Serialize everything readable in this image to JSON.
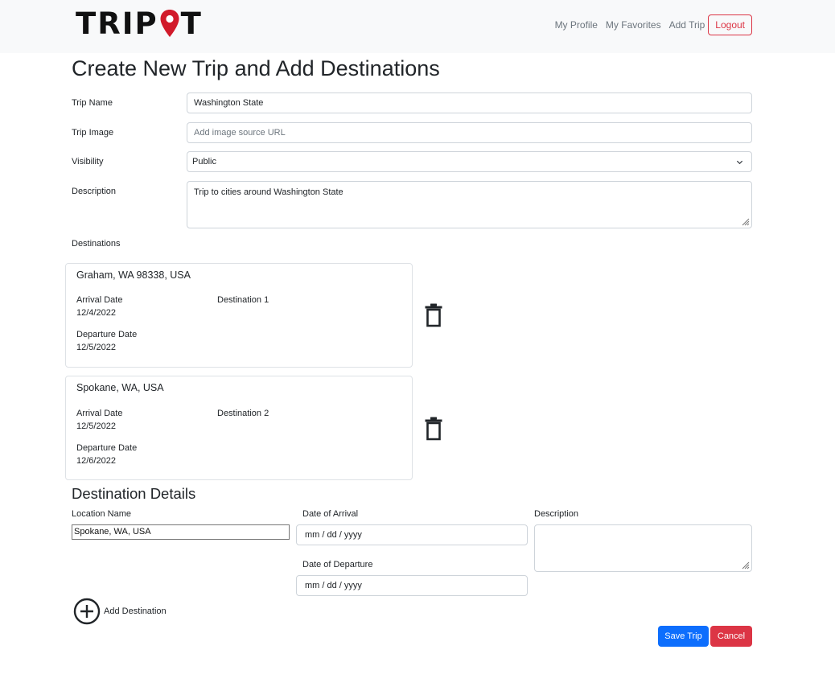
{
  "nav": {
    "logo_prefix": "TRIP",
    "logo_suffix": "T",
    "links": [
      "My Profile",
      "My Favorites",
      "Add Trip"
    ],
    "logout_label": "Logout"
  },
  "page_title": "Create New Trip and Add Destinations",
  "form": {
    "trip_name_label": "Trip Name",
    "trip_name_value": "Washington State",
    "trip_image_label": "Trip Image",
    "trip_image_placeholder": "Add image source URL",
    "visibility_label": "Visibility",
    "visibility_value": "Public",
    "description_label": "Description",
    "description_value": "Trip to cities around Washington State",
    "destinations_label": "Destinations"
  },
  "destinations": [
    {
      "name": "Graham, WA 98338, USA",
      "arrival_label": "Arrival Date",
      "arrival": "12/4/2022",
      "departure_label": "Departure Date",
      "departure": "12/5/2022",
      "tag": "Destination 1"
    },
    {
      "name": "Spokane, WA, USA",
      "arrival_label": "Arrival Date",
      "arrival": "12/5/2022",
      "departure_label": "Departure Date",
      "departure": "12/6/2022",
      "tag": "Destination 2"
    }
  ],
  "details": {
    "title": "Destination Details",
    "location_label": "Location Name",
    "location_value": "Spokane, WA, USA",
    "arrival_label": "Date of Arrival",
    "arrival_placeholder": "mm / dd / yyyy",
    "departure_label": "Date of Departure",
    "departure_placeholder": "mm / dd / yyyy",
    "description_label": "Description"
  },
  "add_destination_label": "Add Destination",
  "buttons": {
    "save": "Save Trip",
    "cancel": "Cancel"
  },
  "colors": {
    "primary": "#0d6efd",
    "danger": "#dc3545",
    "logo_pin": "#d11a2a"
  }
}
